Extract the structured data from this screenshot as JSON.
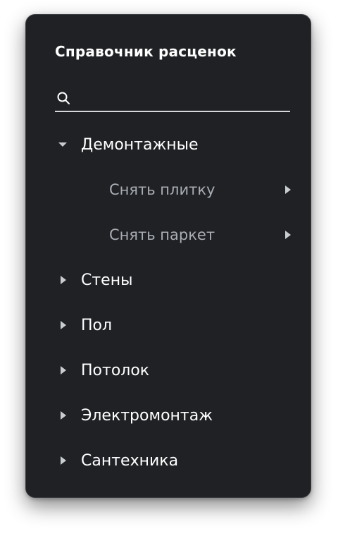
{
  "panel": {
    "title": "Справочник расценок",
    "search": {
      "placeholder": "",
      "value": ""
    }
  },
  "tree": {
    "items": [
      {
        "label": "Демонтажные",
        "expanded": true,
        "children": [
          {
            "label": "Снять плитку"
          },
          {
            "label": "Снять паркет"
          }
        ]
      },
      {
        "label": "Стены",
        "expanded": false
      },
      {
        "label": "Пол",
        "expanded": false
      },
      {
        "label": "Потолок",
        "expanded": false
      },
      {
        "label": "Электромонтаж",
        "expanded": false
      },
      {
        "label": "Сантехника",
        "expanded": false
      }
    ]
  },
  "icons": {
    "search": "search-icon",
    "expanded": "caret-down-icon",
    "collapsed": "caret-right-icon"
  },
  "colors": {
    "panel_bg": "#1f2124",
    "text_primary": "#ffffff",
    "text_secondary": "#a9adb4",
    "caret": "#c9ccd1"
  }
}
